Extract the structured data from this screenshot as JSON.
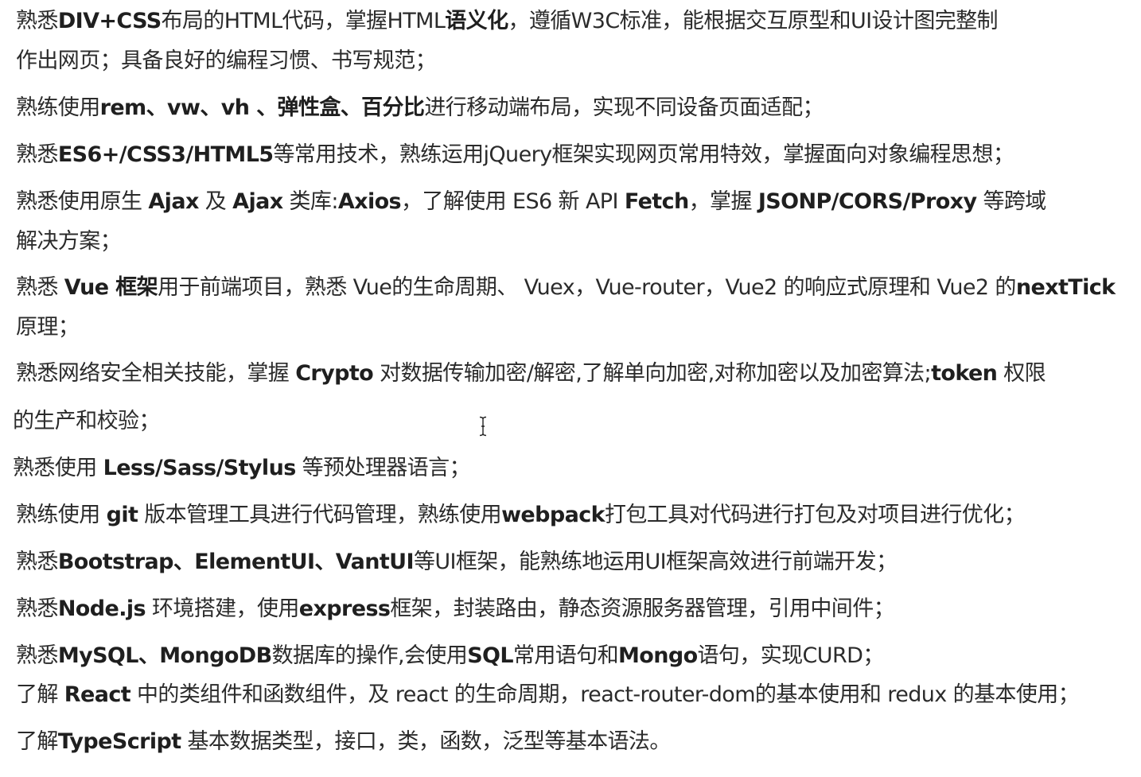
{
  "lines": [
    [
      {
        "t": "熟悉",
        "b": false
      },
      {
        "t": "DIV+CSS",
        "b": true
      },
      {
        "t": "布局的HTML代码，掌握HTML",
        "b": false
      },
      {
        "t": "语义化",
        "b": true
      },
      {
        "t": "，遵循W3C标准，能根据交互原型和UI设计图完整制",
        "b": false
      }
    ],
    [
      {
        "t": "作出网页；具备良好的编程习惯、书写规范；",
        "b": false
      }
    ],
    [
      {
        "t": "熟练使用",
        "b": false
      },
      {
        "t": "rem、vw、vh 、弹性盒、百分比",
        "b": true
      },
      {
        "t": "进行移动端布局，实现不同设备页面适配；",
        "b": false
      }
    ],
    [
      {
        "t": "熟悉",
        "b": false
      },
      {
        "t": "ES6+/CSS3/HTML5",
        "b": true
      },
      {
        "t": "等常用技术，熟练运用jQuery框架实现网页常用特效，掌握面向对象编程思想；",
        "b": false
      }
    ],
    [
      {
        "t": "熟悉使用原生 ",
        "b": false
      },
      {
        "t": "Ajax",
        "b": true
      },
      {
        "t": " 及 ",
        "b": false
      },
      {
        "t": "Ajax",
        "b": true
      },
      {
        "t": " 类库:",
        "b": false
      },
      {
        "t": "Axios",
        "b": true
      },
      {
        "t": "，了解使用 ES6 新 API ",
        "b": false
      },
      {
        "t": "Fetch",
        "b": true
      },
      {
        "t": "，掌握 ",
        "b": false
      },
      {
        "t": "JSONP/CORS/Proxy",
        "b": true
      },
      {
        "t": " 等跨域",
        "b": false
      }
    ],
    [
      {
        "t": "解决方案；",
        "b": false
      }
    ],
    [
      {
        "t": "熟悉 ",
        "b": false
      },
      {
        "t": "Vue 框架",
        "b": true
      },
      {
        "t": "用于前端项目，熟悉 Vue的生命周期、 Vuex，Vue-router，Vue2 的响应式原理和 Vue2 的",
        "b": false
      },
      {
        "t": "nextTick",
        "b": true
      }
    ],
    [
      {
        "t": "原理；",
        "b": false
      }
    ],
    [
      {
        "t": "熟悉网络安全相关技能，掌握 ",
        "b": false
      },
      {
        "t": "Crypto",
        "b": true
      },
      {
        "t": " 对数据传输加密/解密,了解单向加密,对称加密以及加密算法;",
        "b": false
      },
      {
        "t": "token",
        "b": true
      },
      {
        "t": " 权限",
        "b": false
      }
    ],
    [
      {
        "t": "的生产和校验；",
        "b": false
      }
    ],
    [
      {
        "t": "熟悉使用 ",
        "b": false
      },
      {
        "t": "Less/Sass/Stylus",
        "b": true
      },
      {
        "t": " 等预处理器语言；",
        "b": false
      }
    ],
    [
      {
        "t": "熟练使用 ",
        "b": false
      },
      {
        "t": "git",
        "b": true
      },
      {
        "t": " 版本管理工具进行代码管理，熟练使用",
        "b": false
      },
      {
        "t": "webpack",
        "b": true
      },
      {
        "t": "打包工具对代码进行打包及对项目进行优化；",
        "b": false
      }
    ],
    [
      {
        "t": "熟悉",
        "b": false
      },
      {
        "t": "Bootstrap、ElementUI、VantUI",
        "b": true
      },
      {
        "t": "等UI框架，能熟练地运用UI框架高效进行前端开发；",
        "b": false
      }
    ],
    [
      {
        "t": "熟悉",
        "b": false
      },
      {
        "t": "Node.js",
        "b": true
      },
      {
        "t": " 环境搭建，使用",
        "b": false
      },
      {
        "t": "express",
        "b": true
      },
      {
        "t": "框架，封装路由，静态资源服务器管理，引用中间件；",
        "b": false
      }
    ],
    [
      {
        "t": "熟悉",
        "b": false
      },
      {
        "t": "MySQL、MongoDB",
        "b": true
      },
      {
        "t": "数据库的操作,会使用",
        "b": false
      },
      {
        "t": "SQL",
        "b": true
      },
      {
        "t": "常用语句和",
        "b": false
      },
      {
        "t": "Mongo",
        "b": true
      },
      {
        "t": "语句，实现CURD；",
        "b": false
      }
    ],
    [
      {
        "t": "了解 ",
        "b": false
      },
      {
        "t": "React",
        "b": true
      },
      {
        "t": " 中的类组件和函数组件，及 react 的生命周期，react-router-dom的基本使用和 redux 的基本使用；",
        "b": false
      }
    ],
    [
      {
        "t": "了解",
        "b": false
      },
      {
        "t": "TypeScript",
        "b": true
      },
      {
        "t": " 基本数据类型，接口，类，函数，泛型等基本语法。",
        "b": false
      }
    ]
  ]
}
